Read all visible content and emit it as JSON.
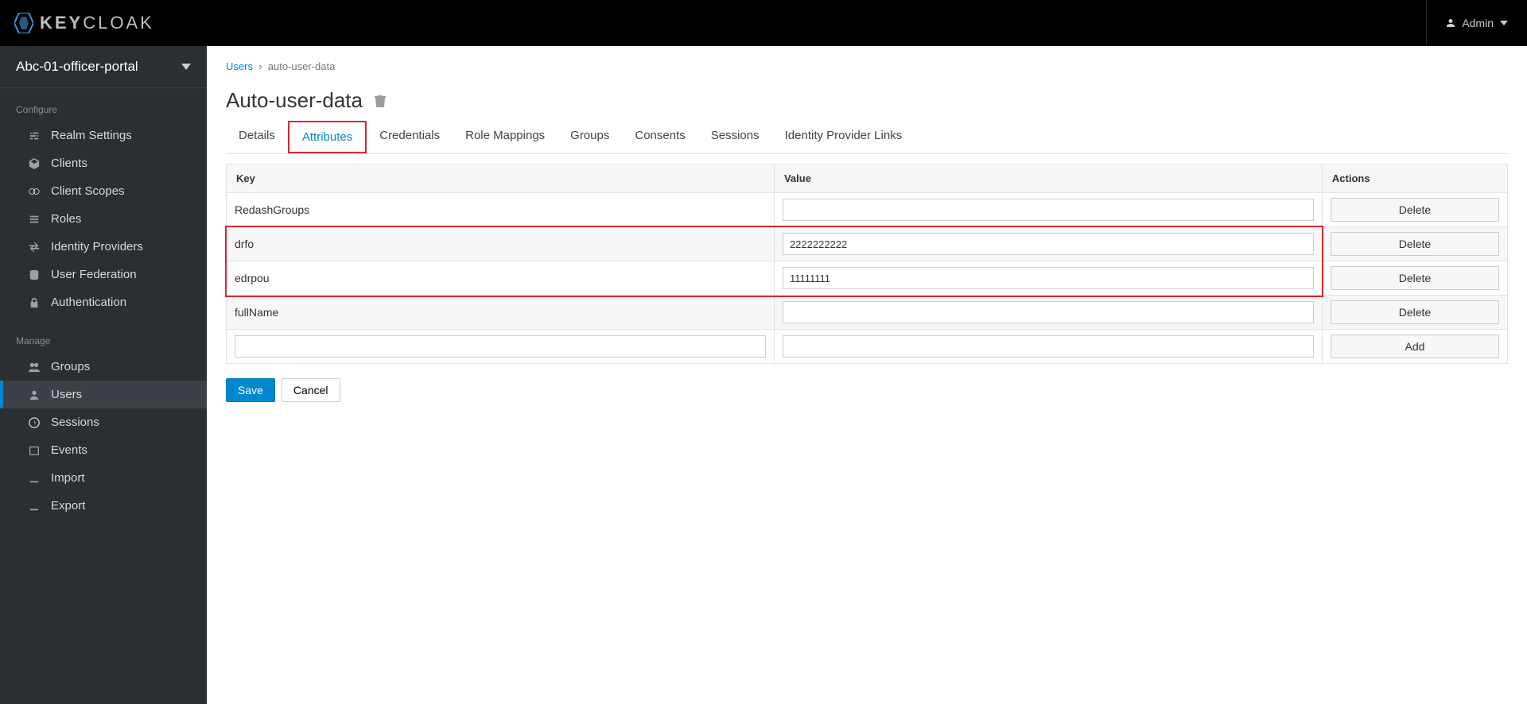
{
  "header": {
    "brand": "KEYCLOAK",
    "admin_label": "Admin"
  },
  "realm": "Abc-01-officer-portal",
  "sidebar": {
    "configure_title": "Configure",
    "manage_title": "Manage",
    "configure": [
      {
        "label": "Realm Settings"
      },
      {
        "label": "Clients"
      },
      {
        "label": "Client Scopes"
      },
      {
        "label": "Roles"
      },
      {
        "label": "Identity Providers"
      },
      {
        "label": "User Federation"
      },
      {
        "label": "Authentication"
      }
    ],
    "manage": [
      {
        "label": "Groups"
      },
      {
        "label": "Users"
      },
      {
        "label": "Sessions"
      },
      {
        "label": "Events"
      },
      {
        "label": "Import"
      },
      {
        "label": "Export"
      }
    ]
  },
  "breadcrumb": {
    "users": "Users",
    "sep": "›",
    "current": "auto-user-data"
  },
  "page_title": "Auto-user-data",
  "tabs": [
    {
      "label": "Details"
    },
    {
      "label": "Attributes"
    },
    {
      "label": "Credentials"
    },
    {
      "label": "Role Mappings"
    },
    {
      "label": "Groups"
    },
    {
      "label": "Consents"
    },
    {
      "label": "Sessions"
    },
    {
      "label": "Identity Provider Links"
    }
  ],
  "table": {
    "headers": {
      "key": "Key",
      "value": "Value",
      "actions": "Actions"
    },
    "rows": [
      {
        "key": "RedashGroups",
        "value": "",
        "action": "Delete",
        "blur": true
      },
      {
        "key": "drfo",
        "value": "2222222222",
        "action": "Delete"
      },
      {
        "key": "edrpou",
        "value": "11111111",
        "action": "Delete"
      },
      {
        "key": "fullName",
        "value": "",
        "action": "Delete",
        "blur": true
      }
    ],
    "add_action": "Add"
  },
  "buttons": {
    "save": "Save",
    "cancel": "Cancel"
  }
}
